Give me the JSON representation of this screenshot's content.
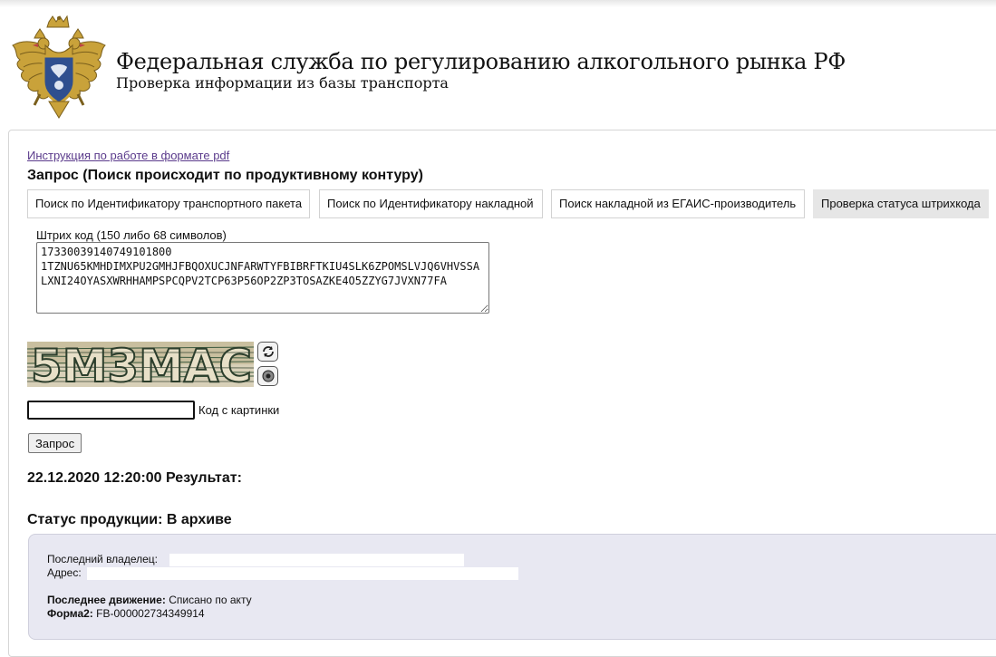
{
  "header": {
    "title": "Федеральная служба по регулированию алкогольного рынка РФ",
    "subtitle": "Проверка информации из базы транспорта"
  },
  "pdf_link": "Инструкция по работе в формате pdf",
  "query_title": "Запрос (Поиск происходит по продуктивному контуру)",
  "tabs": [
    {
      "label": "Поиск по Идентификатору транспортного пакета",
      "active": false
    },
    {
      "label": "Поиск по Идентификатору накладной",
      "active": false
    },
    {
      "label": "Поиск накладной из ЕГАИС-производитель",
      "active": false
    },
    {
      "label": "Проверка статуса штрихкода",
      "active": true
    }
  ],
  "barcode": {
    "label": "Штрих код (150 либо 68 символов)",
    "value": "17330039140749101800​1TZNU65KMHDIMXPU2GMHJFBQOXUCJNFARWTYFBIBRFTKIU4SLK6ZPOMSLVJQ6VHVSSALXNI24OYASXWRHHAMPSPCQPV2TCP63P56OP2ZP3TOSAZKE4O5ZZYG7JVXN77FA"
  },
  "captcha": {
    "text": "5M3MAC",
    "input_value": "",
    "label": "Код с картинки"
  },
  "submit_label": "Запрос",
  "result_heading": "22.12.2020 12:20:00 Результат:",
  "status_heading": "Статус продукции: В архиве",
  "info": {
    "owner_label": "Последний владелец:",
    "address_label": "Адрес:",
    "movement_label": "Последнее движение:",
    "movement_value": "Списано по акту",
    "form2_label": "Форма2:",
    "form2_value": "FB-000002734349914"
  },
  "colors": {
    "link": "#5b3b8c",
    "active_tab": "#e6e6e6",
    "info_box": "#e8e8f2",
    "emblem_gold": "#c9a23a",
    "emblem_blue": "#2f4f8f"
  },
  "icons": {
    "refresh": "refresh-icon",
    "audio": "speaker-icon",
    "emblem": "coat-of-arms-icon"
  }
}
